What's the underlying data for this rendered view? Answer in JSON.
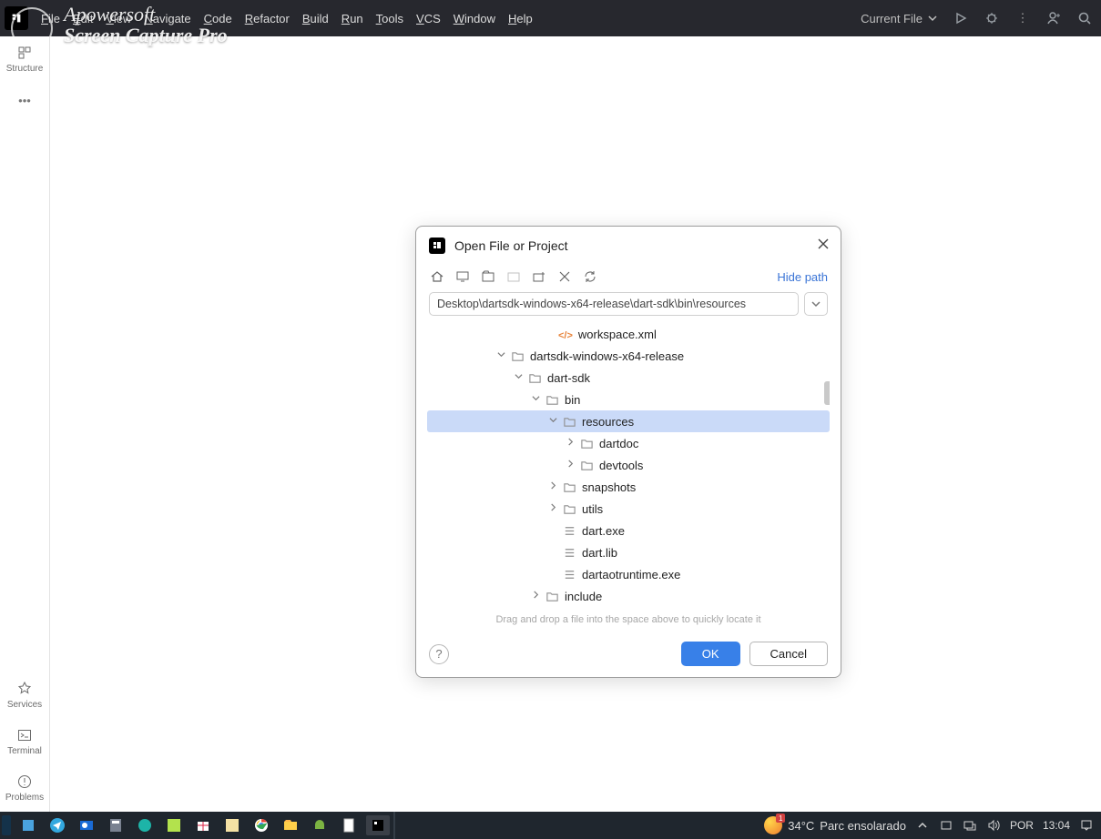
{
  "watermark": {
    "line1": "Apowersoft",
    "line2": "Screen Capture Pro"
  },
  "menus": [
    "File",
    "Edit",
    "View",
    "Navigate",
    "Code",
    "Refactor",
    "Build",
    "Run",
    "Tools",
    "VCS",
    "Window",
    "Help"
  ],
  "top": {
    "current_file": "Current File"
  },
  "rail": {
    "structure": "Structure",
    "services": "Services",
    "terminal": "Terminal",
    "problems": "Problems"
  },
  "dialog": {
    "title": "Open File or Project",
    "hide_path": "Hide path",
    "path": "Desktop\\dartsdk-windows-x64-release\\dart-sdk\\bin\\resources",
    "hint": "Drag and drop a file into the space above to quickly locate it",
    "ok": "OK",
    "cancel": "Cancel"
  },
  "tree": [
    {
      "indent": 128,
      "chev": "none",
      "icon": "xml",
      "label": "workspace.xml"
    },
    {
      "indent": 76,
      "chev": "down",
      "icon": "folder",
      "label": "dartsdk-windows-x64-release"
    },
    {
      "indent": 95,
      "chev": "down",
      "icon": "folder",
      "label": "dart-sdk"
    },
    {
      "indent": 114,
      "chev": "down",
      "icon": "folder",
      "label": "bin"
    },
    {
      "indent": 133,
      "chev": "down",
      "icon": "folder",
      "label": "resources",
      "selected": true
    },
    {
      "indent": 152,
      "chev": "right",
      "icon": "folder",
      "label": "dartdoc"
    },
    {
      "indent": 152,
      "chev": "right",
      "icon": "folder",
      "label": "devtools"
    },
    {
      "indent": 133,
      "chev": "right",
      "icon": "folder",
      "label": "snapshots"
    },
    {
      "indent": 133,
      "chev": "right",
      "icon": "folder",
      "label": "utils"
    },
    {
      "indent": 133,
      "chev": "none",
      "icon": "file",
      "label": "dart.exe"
    },
    {
      "indent": 133,
      "chev": "none",
      "icon": "file",
      "label": "dart.lib"
    },
    {
      "indent": 133,
      "chev": "none",
      "icon": "file",
      "label": "dartaotruntime.exe"
    },
    {
      "indent": 114,
      "chev": "right",
      "icon": "folder",
      "label": "include"
    }
  ],
  "taskbar": {
    "temp": "34°C",
    "weather": "Parc ensolarado",
    "lang": "POR",
    "time": "13:04",
    "badge": "1"
  }
}
